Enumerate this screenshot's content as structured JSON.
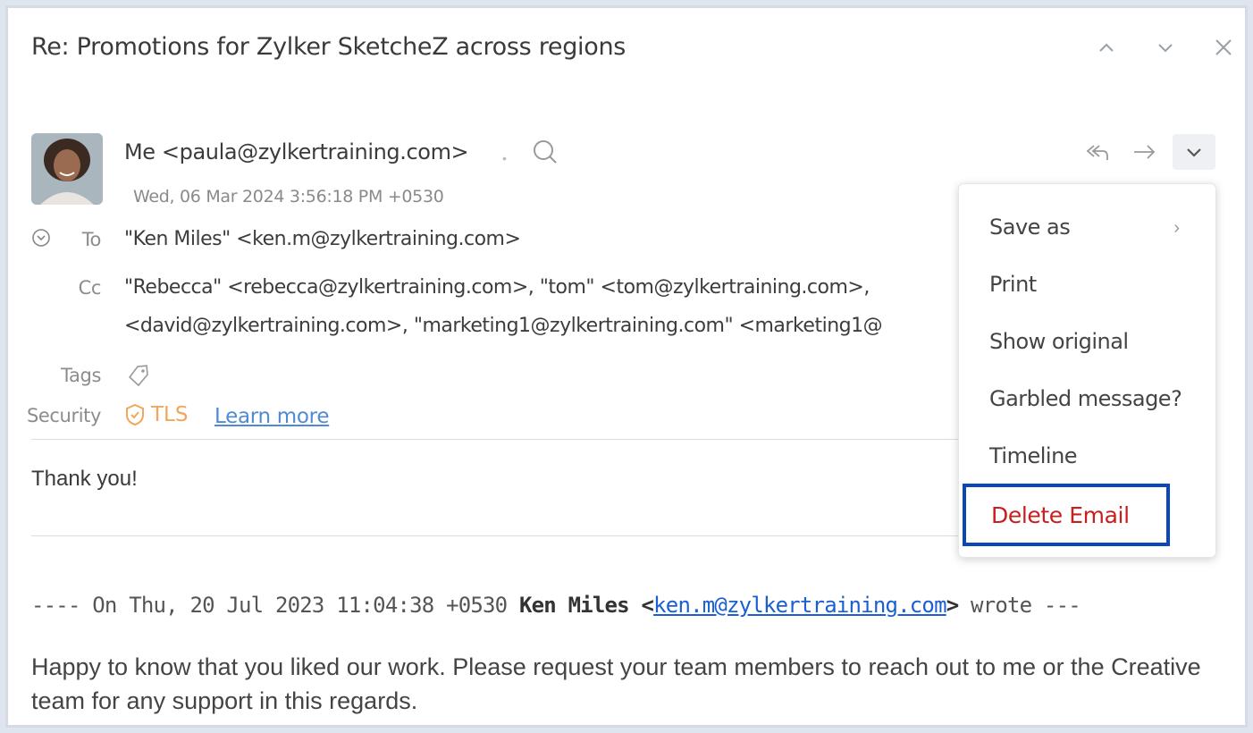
{
  "email": {
    "subject": "Re: Promotions for Zylker SketcheZ across regions",
    "sender": "Me <paula@zylkertraining.com>",
    "date": "Wed, 06 Mar 2024 3:56:18 PM +0530",
    "to_label": "To",
    "to_value": "\"Ken Miles\" <ken.m@zylkertraining.com>",
    "cc_label": "Cc",
    "cc_line1": "\"Rebecca\" <rebecca@zylkertraining.com>, \"tom\" <tom@zylkertraining.com>,",
    "cc_line2": "<david@zylkertraining.com>, \"marketing1@zylkertraining.com\" <marketing1@",
    "tags_label": "Tags",
    "security_label": "Security",
    "tls": "TLS",
    "learn_more": "Learn more",
    "body": "Thank you!",
    "quote_prefix": "---- On Thu, 20 Jul 2023 11:04:38 +0530 ",
    "quote_name": "Ken Miles",
    "quote_lt": " <",
    "quote_email": "ken.m@zylkertraining.com",
    "quote_suffix": "> wrote ---",
    "quote_body": "Happy to know that you liked our work. Please request your team members to reach out to me or the Creative team for any support in this regards."
  },
  "menu": {
    "items": [
      "Save as",
      "Print",
      "Show original",
      "Garbled message?",
      "Timeline"
    ],
    "delete": "Delete Email",
    "chevron": "›"
  },
  "colors": {
    "tls": "#f2a65a",
    "link": "#4f8ad4",
    "delete": "#c81e1e",
    "highlight": "#0a47b8"
  }
}
